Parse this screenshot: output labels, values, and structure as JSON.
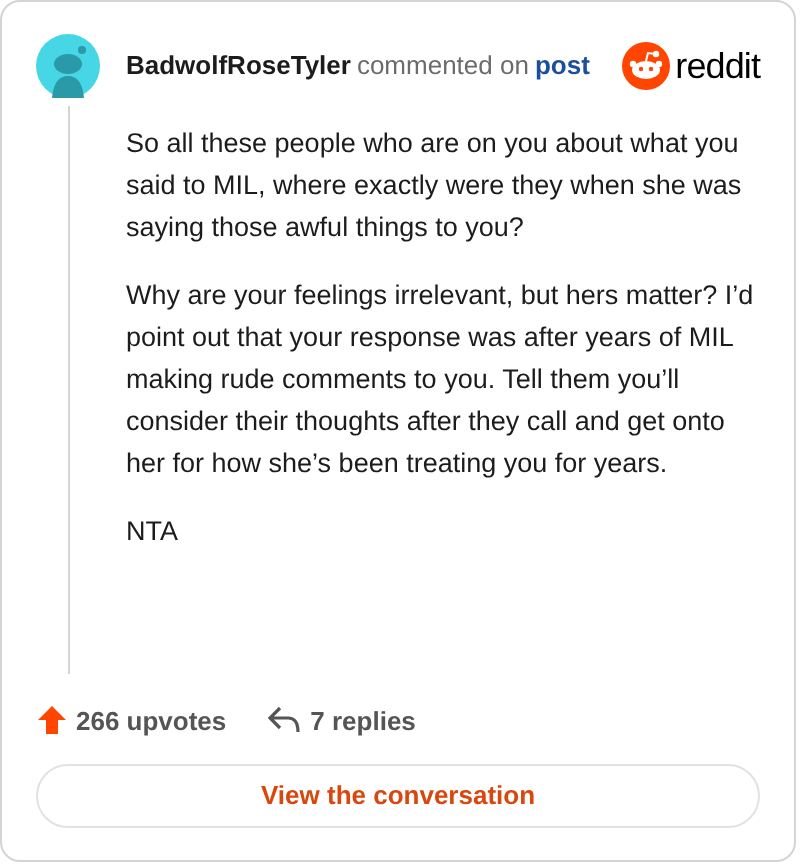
{
  "header": {
    "author": "BadwolfRoseTyler",
    "action": "commented on",
    "link": "post",
    "brand": "reddit"
  },
  "comment": {
    "paragraphs": [
      "So all these people who are on you about what you said to MIL, where exactly were they when she was saying those awful things to you?",
      "Why are your feelings irrelevant, but hers matter? I’d point out that your response was after years of MIL making rude comments to you. Tell them you’ll consider their thoughts after they call and get onto her for how she’s been treating you for years.",
      "NTA"
    ]
  },
  "footer": {
    "upvotes": "266 upvotes",
    "replies": "7 replies",
    "button": "View the conversation"
  }
}
